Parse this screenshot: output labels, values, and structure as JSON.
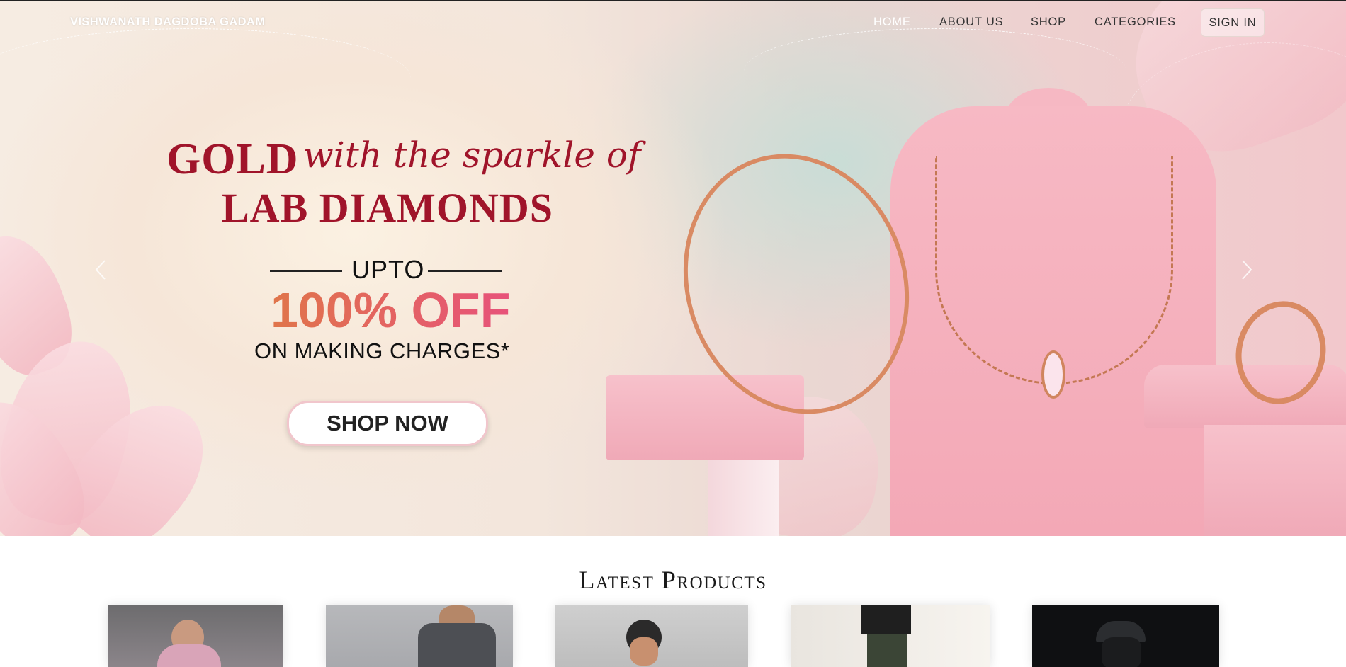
{
  "brand": "VISHWANATH DAGDOBA GADAM",
  "nav": {
    "home": "HOME",
    "about": "ABOUT US",
    "shop": "SHOP",
    "categories": "CATEGORIES",
    "signin": "SIGN IN"
  },
  "hero": {
    "gold": "GOLD",
    "script": "with the sparkle of",
    "diamonds": "LAB DIAMONDS",
    "upto": "UPTO",
    "offer": "100% OFF",
    "making": "ON MAKING CHARGES*",
    "cta": "SHOP NOW"
  },
  "carousel": {
    "prev_icon": "chevron-left-icon",
    "next_icon": "chevron-right-icon"
  },
  "latest": {
    "title": "Latest Products",
    "products": [
      {
        "name": "product-card-1"
      },
      {
        "name": "product-card-2"
      },
      {
        "name": "product-card-3"
      },
      {
        "name": "product-card-4"
      },
      {
        "name": "product-card-5"
      }
    ]
  },
  "colors": {
    "accent": "#a0142a",
    "offer_start": "#e0754a",
    "offer_end": "#e7527a"
  }
}
